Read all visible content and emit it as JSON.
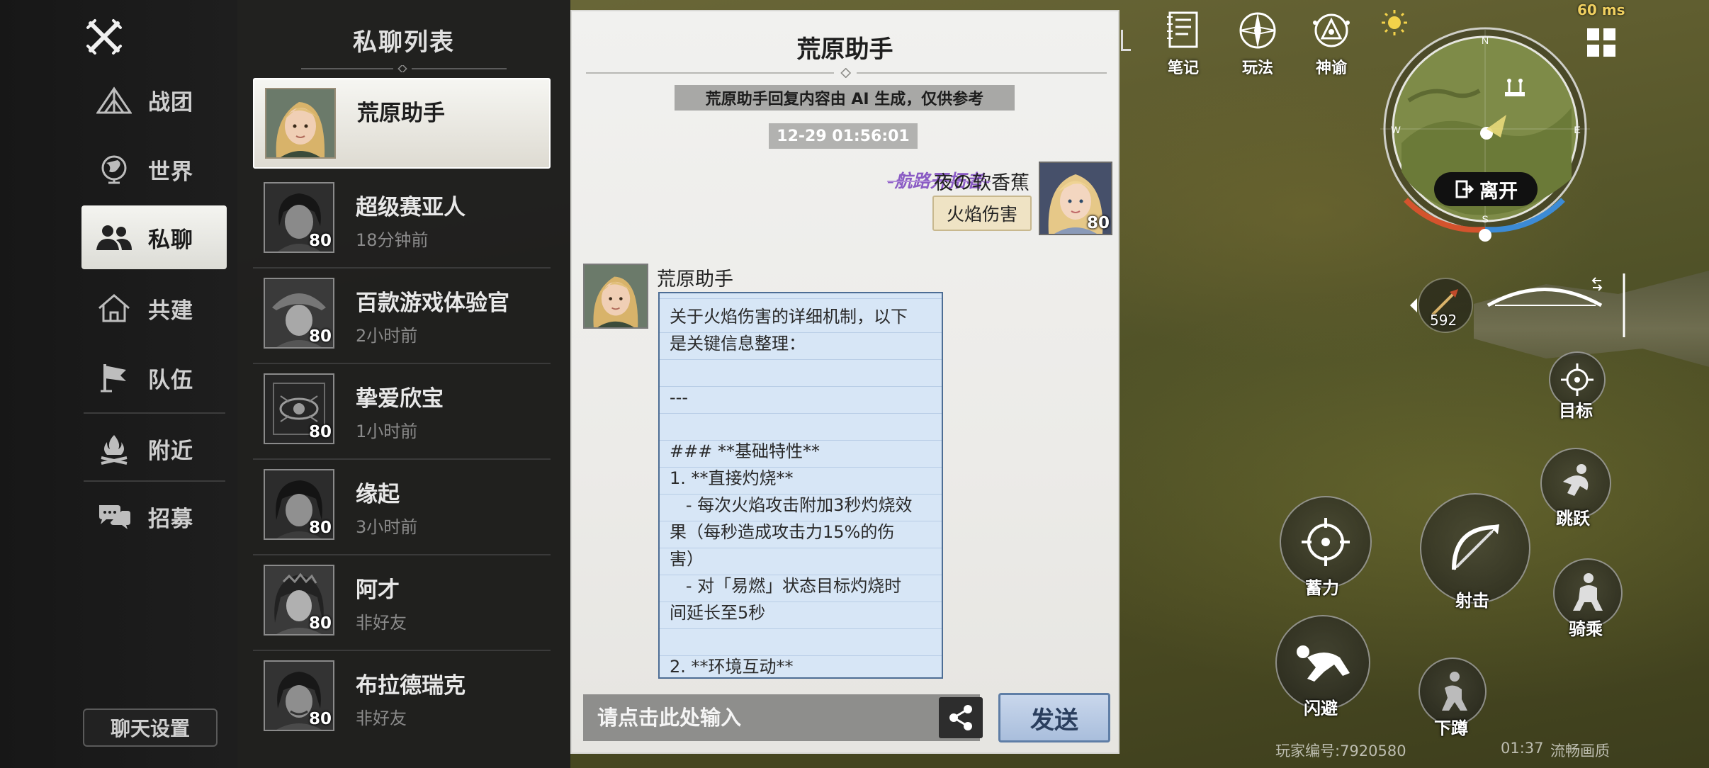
{
  "sidebar": {
    "items": [
      {
        "label": "战团",
        "icon": "tent-icon"
      },
      {
        "label": "世界",
        "icon": "globe-icon"
      },
      {
        "label": "私聊",
        "icon": "people-icon"
      },
      {
        "label": "共建",
        "icon": "house-icon"
      },
      {
        "label": "队伍",
        "icon": "flag-icon"
      },
      {
        "label": "附近",
        "icon": "campfire-icon"
      },
      {
        "label": "招募",
        "icon": "speech-bubbles-icon"
      }
    ],
    "active": "私聊",
    "settings_label": "聊天设置"
  },
  "dm_list": {
    "title": "私聊列表",
    "contacts": [
      {
        "name": "荒原助手",
        "sub": "",
        "level": ""
      },
      {
        "name": "超级赛亚人",
        "sub": "18分钟前",
        "level": "80"
      },
      {
        "name": "百款游戏体验官",
        "sub": "2小时前",
        "level": "80"
      },
      {
        "name": "挚爱欣宝",
        "sub": "1小时前",
        "level": "80"
      },
      {
        "name": "缘起",
        "sub": "3小时前",
        "level": "80"
      },
      {
        "name": "阿才",
        "sub": "非好友",
        "level": "80"
      },
      {
        "name": "布拉德瑞克",
        "sub": "非好友",
        "level": "80"
      }
    ]
  },
  "chat": {
    "title": "荒原助手",
    "ai_notice": "荒原助手回复内容由 AI 生成，仅供参考",
    "timestamp": "12-29 01:56:01",
    "me": {
      "tag": "-航路开拓者-",
      "name": "夜の软香蕉",
      "message": "火焰伤害",
      "level": "80"
    },
    "bot": {
      "name": "荒原助手",
      "lines": [
        "关于火焰伤害的详细机制，以下",
        "是关键信息整理：",
        "",
        "---",
        "",
        "### **基础特性**",
        "1. **直接灼烧**",
        "   - 每次火焰攻击附加3秒灼烧效",
        "果（每秒造成攻击力15%的伤",
        "害）",
        "   - 对「易燃」状态目标灼烧时",
        "间延长至5秒",
        "",
        "2. **环境互动**"
      ]
    },
    "input_placeholder": "请点击此处输入",
    "send_label": "发送"
  },
  "hud": {
    "fps": "60 ms",
    "top_buttons": [
      {
        "label": "笔记",
        "icon": "notebook-icon"
      },
      {
        "label": "玩法",
        "icon": "compass-rose-icon"
      },
      {
        "label": "神谕",
        "icon": "oracle-icon"
      }
    ],
    "leave_label": "离开",
    "ammo": "592",
    "compass": {
      "n": "N",
      "e": "E",
      "s": "S",
      "w": "W"
    },
    "actions": {
      "target": "目标",
      "jump": "跳跃",
      "charge": "蓄力",
      "shoot": "射击",
      "ride": "骑乘",
      "dodge": "闪避",
      "crouch": "下蹲"
    },
    "player_id": "玩家编号:7920580",
    "clock": "01:37",
    "quality": "流畅画质"
  },
  "colors": {
    "accent_purple": "#8a5bc4",
    "bot_bubble": "#d7e6f6",
    "my_bubble": "#efe3c4",
    "send_button": "#a9bedc"
  }
}
